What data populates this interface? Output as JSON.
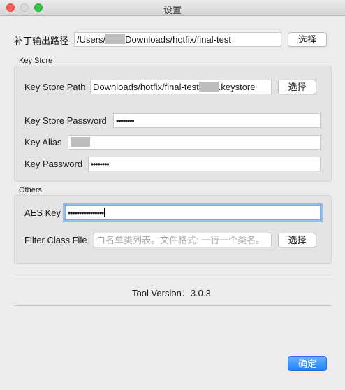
{
  "window": {
    "title": "设置"
  },
  "patch": {
    "label": "补丁输出路径",
    "path_prefix": "/Users/",
    "path_suffix": "Downloads/hotfix/final-test",
    "button": "选择"
  },
  "keystore": {
    "group_title": "Key Store",
    "path_label": "Key Store Path",
    "path_prefix": "Downloads/hotfix/final-test",
    "path_suffix": ".keystore",
    "path_button": "选择",
    "password_label": "Key Store Password",
    "password_value": "••••••••",
    "alias_label": "Key Alias",
    "key_password_label": "Key Password",
    "key_password_value": "••••••••"
  },
  "others": {
    "group_title": "Others",
    "aes_label": "AES Key",
    "aes_value": "••••••••••••••••",
    "filter_label": "Filter Class File",
    "filter_placeholder": "白名单类列表。文件格式: 一行一个类名。",
    "filter_button": "选择"
  },
  "footer": {
    "version_label": "Tool Version：",
    "version_value": "3.0.3",
    "ok_button": "确定"
  }
}
